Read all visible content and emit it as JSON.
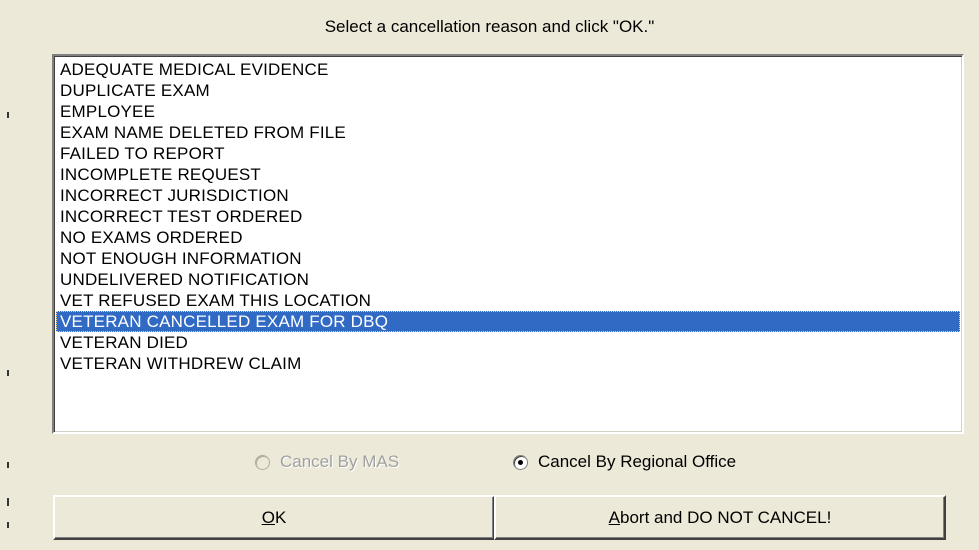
{
  "dialog": {
    "prompt": "Select a cancellation reason and click \"OK.\"",
    "reasons": [
      "ADEQUATE MEDICAL EVIDENCE",
      "DUPLICATE EXAM",
      "EMPLOYEE",
      "EXAM NAME DELETED FROM FILE",
      "FAILED TO REPORT",
      "INCOMPLETE REQUEST",
      "INCORRECT JURISDICTION",
      "INCORRECT TEST ORDERED",
      "NO EXAMS ORDERED",
      "NOT ENOUGH INFORMATION",
      "UNDELIVERED NOTIFICATION",
      "VET REFUSED EXAM THIS LOCATION",
      "VETERAN CANCELLED EXAM FOR DBQ",
      "VETERAN DIED",
      "VETERAN WITHDREW CLAIM"
    ],
    "selected_reason": "VETERAN CANCELLED EXAM FOR DBQ",
    "radio_options": {
      "mas": {
        "label": "Cancel By MAS",
        "enabled": false,
        "checked": false
      },
      "regional_office": {
        "label": "Cancel By Regional Office",
        "enabled": true,
        "checked": true
      }
    },
    "buttons": {
      "ok": {
        "mnemonic": "O",
        "rest": "K"
      },
      "abort": {
        "mnemonic": "A",
        "rest": "bort and DO NOT CANCEL!"
      }
    }
  },
  "colors": {
    "dialog_bg": "#ece9d8",
    "selection_bg": "#316ac5",
    "selection_text": "#ffffff"
  }
}
